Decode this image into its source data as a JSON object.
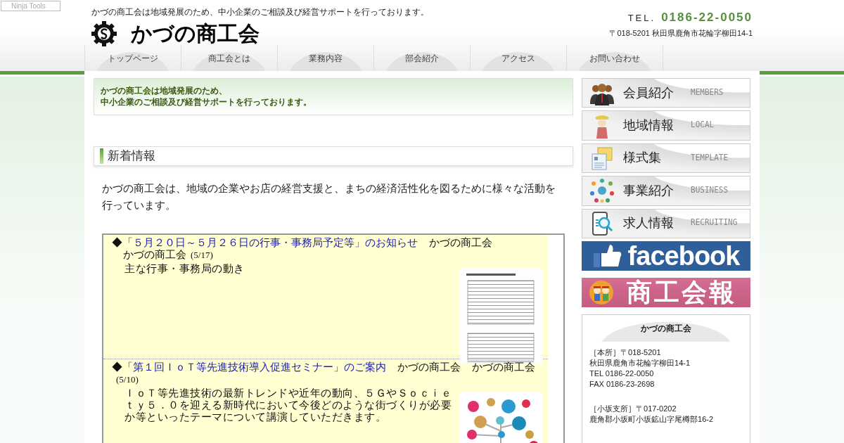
{
  "badge": "Ninja Tools",
  "header": {
    "tagline": "かづの商工会は地域発展のため、中小企業のご相談及び経営サポートを行っております。",
    "title": "かづの商工会",
    "tel_label": "TEL.",
    "tel": "0186-22-0050",
    "address": "〒018-5201 秋田県鹿角市花輪字柳田14-1"
  },
  "nav": [
    {
      "label": "トップページ"
    },
    {
      "label": "商工会とは"
    },
    {
      "label": "業務内容"
    },
    {
      "label": "部会紹介"
    },
    {
      "label": "アクセス"
    },
    {
      "label": "お問い合わせ"
    }
  ],
  "intro": [
    "かづの商工会は地域発展のため、",
    "中小企業のご相談及び経営サポートを行っております。"
  ],
  "section_title": "新着情報",
  "lead": "かづの商工会は、地域の企業やお店の経営支援と、まちの経済活性化を図るために様々な活動を行っています。",
  "news": [
    {
      "marker": "◆",
      "title": "「５月２０日～５月２６日の行事・事務局予定等」のお知らせ",
      "authors": [
        "かづの商工会",
        "かづの商工会"
      ],
      "date": "(5/17)",
      "body": "主な行事・事務局の動き",
      "kind": "document"
    },
    {
      "marker": "◆",
      "title": "「第１回ＩｏＴ等先進技術導入促進セミナー」のご案内",
      "authors": [
        "かづの商工会",
        "かづの商工会"
      ],
      "date": "(5/10)",
      "body": "ＩｏＴ等先進技術の最新トレンドや近年の動向、５ＧやＳｏｃｉｅｔｙ５．０を迎える新時代において今後どのような街づくりが必要か等といったテーマについて講演していただきます。",
      "kind": "poster"
    }
  ],
  "side_menu": [
    {
      "label": "会員紹介",
      "sub": "MEMBERS",
      "kind": "people"
    },
    {
      "label": "地域情報",
      "sub": "LOCAL",
      "kind": "figure"
    },
    {
      "label": "様式集",
      "sub": "TEMPLATE",
      "kind": "envelope"
    },
    {
      "label": "事業紹介",
      "sub": "BUSINESS",
      "kind": "network"
    },
    {
      "label": "求人情報",
      "sub": "RECRUITING",
      "kind": "job"
    }
  ],
  "facebook": "facebook",
  "newsletter": "商工会報",
  "info": {
    "title": "かづの商工会",
    "blocks": [
      [
        "［本所］〒018-5201",
        "秋田県鹿角市花輪字柳田14-1",
        "TEL 0186-22-0050",
        "FAX 0186-23-2698"
      ],
      [
        "［小坂支所］〒017-0202",
        "鹿角郡小坂町小坂鉱山字尾樽部16-2"
      ]
    ]
  }
}
